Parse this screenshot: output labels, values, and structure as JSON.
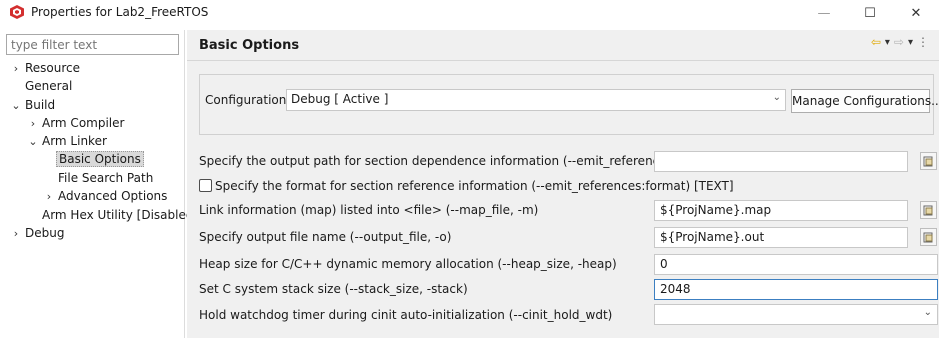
{
  "window": {
    "title": "Properties for Lab2_FreeRTOS",
    "minimize": "—",
    "maximize": "☐",
    "close": "✕"
  },
  "sidebar": {
    "filter_placeholder": "type filter text",
    "items": [
      {
        "label": "Resource",
        "chevron": "›",
        "depth": 0
      },
      {
        "label": "General",
        "chevron": "",
        "depth": 0
      },
      {
        "label": "Build",
        "chevron": "⌄",
        "depth": 0
      },
      {
        "label": "Arm Compiler",
        "chevron": "›",
        "depth": 1
      },
      {
        "label": "Arm Linker",
        "chevron": "⌄",
        "depth": 1
      },
      {
        "label": "Basic Options",
        "chevron": "",
        "depth": 2,
        "selected": true
      },
      {
        "label": "File Search Path",
        "chevron": "",
        "depth": 2
      },
      {
        "label": "Advanced Options",
        "chevron": "›",
        "depth": 2
      },
      {
        "label": "Arm Hex Utility  [Disabled",
        "chevron": "",
        "depth": 1
      },
      {
        "label": "Debug",
        "chevron": "›",
        "depth": 0
      }
    ]
  },
  "header": {
    "title": "Basic Options",
    "back_icon": "⇦",
    "forward_icon": "⇨",
    "menu_icon": "⋮",
    "dropdown_icon": "▾"
  },
  "configuration": {
    "label": "Configuration:",
    "selected": "Debug  [ Active ]",
    "manage_label": "Manage Configurations..."
  },
  "options": {
    "emit_references_file": {
      "label": "Specify the output path for section dependence information (--emit_references:file)",
      "value": ""
    },
    "emit_references_format": {
      "label": "Specify the format for section reference information (--emit_references:format) [TEXT]",
      "checked": false
    },
    "map_file": {
      "label": "Link information (map) listed into <file> (--map_file, -m)",
      "value": "${ProjName}.map"
    },
    "output_file": {
      "label": "Specify output file name (--output_file, -o)",
      "value": "${ProjName}.out"
    },
    "heap_size": {
      "label": "Heap size for C/C++ dynamic memory allocation (--heap_size, -heap)",
      "value": "0"
    },
    "stack_size": {
      "label": "Set C system stack size (--stack_size, -stack)",
      "value": "2048"
    },
    "cinit_hold_wdt": {
      "label": "Hold watchdog timer during cinit auto-initialization (--cinit_hold_wdt)",
      "value": ""
    }
  },
  "colors": {
    "accent": "#3c7fc1",
    "app_icon": "#d32f2f",
    "nav_arrow": "#e0a800"
  }
}
